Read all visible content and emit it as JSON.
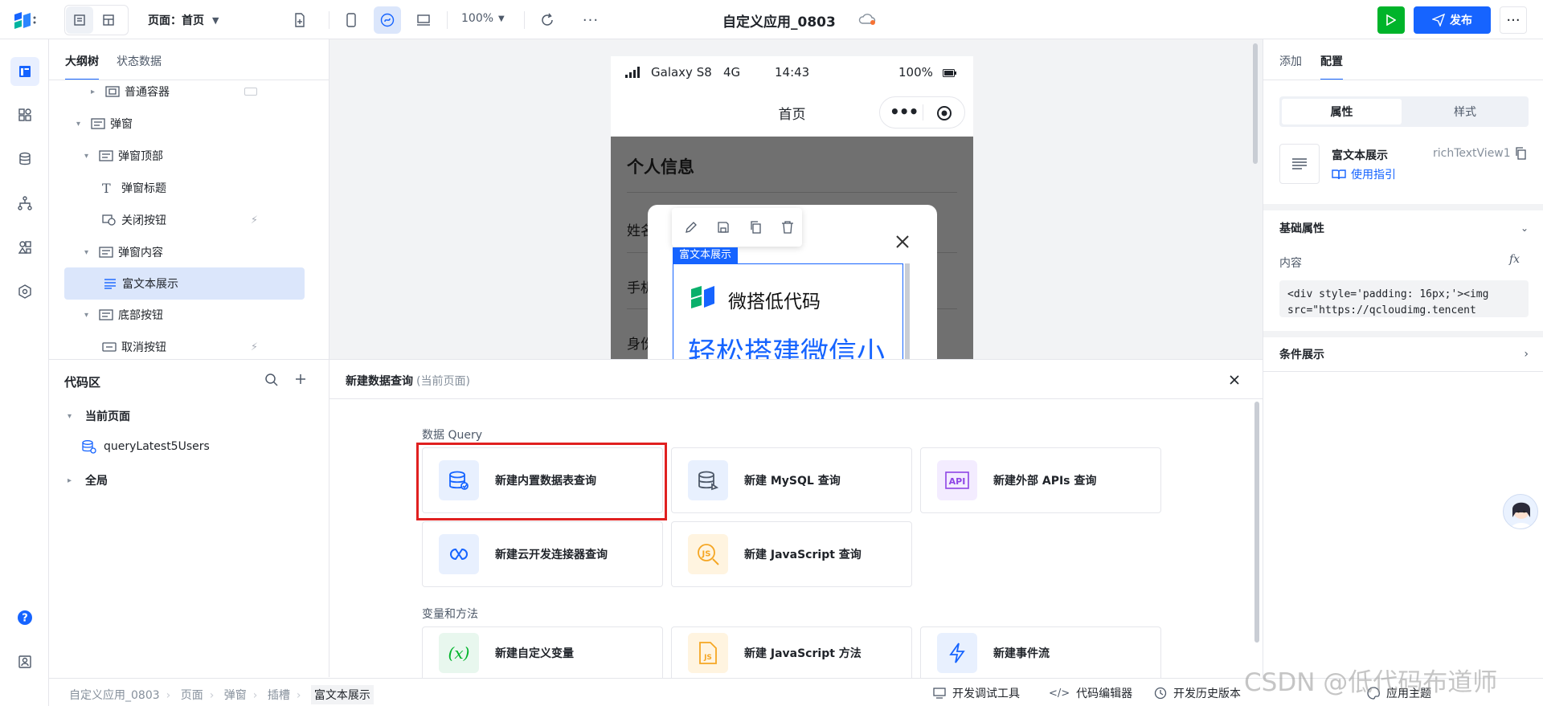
{
  "topbar": {
    "page_selector": "页面：首页",
    "zoom": "100%",
    "app_title": "自定义应用_0803",
    "publish": "发布"
  },
  "outline": {
    "tabs": [
      "大纲树",
      "状态数据"
    ],
    "rows": [
      {
        "label": "普通容器"
      },
      {
        "label": "弹窗"
      },
      {
        "label": "弹窗顶部"
      },
      {
        "label": "弹窗标题"
      },
      {
        "label": "关闭按钮"
      },
      {
        "label": "弹窗内容"
      },
      {
        "label": "富文本展示"
      },
      {
        "label": "底部按钮"
      },
      {
        "label": "取消按钮"
      }
    ]
  },
  "codearea": {
    "title": "代码区",
    "current_page": "当前页面",
    "query_item": "queryLatest5Users",
    "global": "全局"
  },
  "phone": {
    "device": "Galaxy S8",
    "network": "4G",
    "time": "14:43",
    "battery": "100%",
    "page_title": "首页",
    "section_title": "个人信息",
    "row1": "姓名",
    "row2": "手机",
    "row3": "身份",
    "selection_label": "富文本展示",
    "brand": "微搭低代码",
    "headline": "轻松搭建微信小"
  },
  "dialog": {
    "title": "新建数据查询",
    "subtitle": "(当前页面)",
    "section1": "数据 Query",
    "section2": "变量和方法",
    "cards": [
      "新建内置数据表查询",
      "新建 MySQL 查询",
      "新建外部 APIs 查询",
      "新建云开发连接器查询",
      "新建 JavaScript 查询",
      "新建自定义变量",
      "新建 JavaScript 方法",
      "新建事件流"
    ]
  },
  "right": {
    "tabs": [
      "添加",
      "配置"
    ],
    "seg": [
      "属性",
      "样式"
    ],
    "component_name": "富文本展示",
    "component_id": "richTextView1",
    "guide": "使用指引",
    "basic": "基础属性",
    "content_label": "内容",
    "fx": "fx",
    "code_line1": "<div style='padding: 16px;'><img",
    "code_line2": "src=\"https://qcloudimg.tencent",
    "cond": "条件展示"
  },
  "status": {
    "crumbs": [
      "自定义应用_0803",
      "页面",
      "弹窗",
      "插槽",
      "富文本展示"
    ],
    "tools": [
      "开发调试工具",
      "代码编辑器",
      "开发历史版本",
      "应用主题"
    ]
  },
  "watermark": "CSDN @低代码布道师",
  "colors": {
    "accent": "#1664ff",
    "publish": "#1664ff",
    "run": "#00b42a",
    "highlight": "#e02020"
  }
}
